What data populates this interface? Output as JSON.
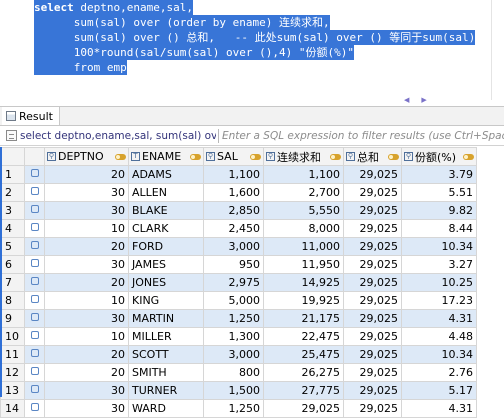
{
  "editor": {
    "lines": [
      {
        "kw": "select",
        "rest": " deptno,ename,sal,"
      },
      {
        "kw": "",
        "rest": "      sum(sal) over (order by ename) 连续求和,"
      },
      {
        "kw": "",
        "rest": "      sum(sal) over () 总和,   -- 此处sum(sal) over () 等同于sum(sal)"
      },
      {
        "kw": "",
        "rest": "      100*round(sal/sum(sal) over (),4) \"份额(%)\""
      },
      {
        "kw": "",
        "rest": "      from emp"
      }
    ]
  },
  "results_tab": {
    "label": "Result"
  },
  "filter": {
    "query": "select deptno,ename,sal, sum(sal) over (orc",
    "placeholder": "Enter a SQL expression to filter results (use Ctrl+Space)"
  },
  "grid": {
    "columns": [
      "DEPTNO",
      "ENAME",
      "SAL",
      "连续求和",
      "总和",
      "份额(%)"
    ],
    "rows": [
      {
        "n": "1",
        "deptno": "20",
        "ename": "ADAMS",
        "sal": "1,100",
        "cum": "1,100",
        "total": "29,025",
        "share": "3.79"
      },
      {
        "n": "2",
        "deptno": "30",
        "ename": "ALLEN",
        "sal": "1,600",
        "cum": "2,700",
        "total": "29,025",
        "share": "5.51"
      },
      {
        "n": "3",
        "deptno": "30",
        "ename": "BLAKE",
        "sal": "2,850",
        "cum": "5,550",
        "total": "29,025",
        "share": "9.82"
      },
      {
        "n": "4",
        "deptno": "10",
        "ename": "CLARK",
        "sal": "2,450",
        "cum": "8,000",
        "total": "29,025",
        "share": "8.44"
      },
      {
        "n": "5",
        "deptno": "20",
        "ename": "FORD",
        "sal": "3,000",
        "cum": "11,000",
        "total": "29,025",
        "share": "10.34"
      },
      {
        "n": "6",
        "deptno": "30",
        "ename": "JAMES",
        "sal": "950",
        "cum": "11,950",
        "total": "29,025",
        "share": "3.27"
      },
      {
        "n": "7",
        "deptno": "20",
        "ename": "JONES",
        "sal": "2,975",
        "cum": "14,925",
        "total": "29,025",
        "share": "10.25"
      },
      {
        "n": "8",
        "deptno": "10",
        "ename": "KING",
        "sal": "5,000",
        "cum": "19,925",
        "total": "29,025",
        "share": "17.23"
      },
      {
        "n": "9",
        "deptno": "30",
        "ename": "MARTIN",
        "sal": "1,250",
        "cum": "21,175",
        "total": "29,025",
        "share": "4.31"
      },
      {
        "n": "10",
        "deptno": "10",
        "ename": "MILLER",
        "sal": "1,300",
        "cum": "22,475",
        "total": "29,025",
        "share": "4.48"
      },
      {
        "n": "11",
        "deptno": "20",
        "ename": "SCOTT",
        "sal": "3,000",
        "cum": "25,475",
        "total": "29,025",
        "share": "10.34"
      },
      {
        "n": "12",
        "deptno": "20",
        "ename": "SMITH",
        "sal": "800",
        "cum": "26,275",
        "total": "29,025",
        "share": "2.76"
      },
      {
        "n": "13",
        "deptno": "30",
        "ename": "TURNER",
        "sal": "1,500",
        "cum": "27,775",
        "total": "29,025",
        "share": "5.17"
      },
      {
        "n": "14",
        "deptno": "30",
        "ename": "WARD",
        "sal": "1,250",
        "cum": "29,025",
        "total": "29,025",
        "share": "4.31"
      }
    ]
  },
  "icons": {
    "column_type": "column-type-icon",
    "sort_key": "key-icon",
    "row_link": "row-link-icon",
    "filter": "filter-icon"
  },
  "colors": {
    "selection": "#3875d7",
    "row_highlight": "#dde9f7"
  }
}
